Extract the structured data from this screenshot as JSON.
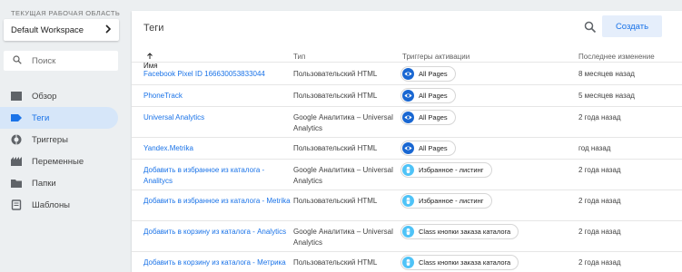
{
  "colors": {
    "accent": "#1a73e8",
    "chip_all_pages": "#1967d2",
    "chip_click": "#4fc3f7"
  },
  "sidebar": {
    "workspace_caption": "ТЕКУЩАЯ РАБОЧАЯ ОБЛАСТЬ",
    "workspace_name": "Default Workspace",
    "search_placeholder": "Поиск",
    "items": [
      {
        "label": "Обзор",
        "icon": "overview-icon"
      },
      {
        "label": "Теги",
        "icon": "tag-icon",
        "active": true
      },
      {
        "label": "Триггеры",
        "icon": "trigger-icon"
      },
      {
        "label": "Переменные",
        "icon": "variables-icon"
      },
      {
        "label": "Папки",
        "icon": "folder-icon"
      },
      {
        "label": "Шаблоны",
        "icon": "template-icon"
      }
    ]
  },
  "panel": {
    "title": "Теги",
    "create_label": "Создать",
    "columns": {
      "name": "Имя",
      "type": "Тип",
      "triggers": "Триггеры активации",
      "modified": "Последнее изменение"
    },
    "rows": [
      {
        "name": "Facebook Pixel ID 166630053833044",
        "type": "Пользовательский HTML",
        "trigger": "All Pages",
        "trigger_icon": "eye-icon",
        "modified": "8 месяцев назад"
      },
      {
        "name": "PhoneTrack",
        "type": "Пользовательский HTML",
        "trigger": "All Pages",
        "trigger_icon": "eye-icon",
        "modified": "5 месяцев назад"
      },
      {
        "name": "Universal Analytics",
        "type": "Google Аналитика – Universal Analytics",
        "trigger": "All Pages",
        "trigger_icon": "eye-icon",
        "modified": "2 года назад"
      },
      {
        "name": "Yandex.Metrika",
        "type": "Пользовательский HTML",
        "trigger": "All Pages",
        "trigger_icon": "eye-icon",
        "modified": "год назад"
      },
      {
        "name": "Добавить в избранное из каталога - Analitycs",
        "type": "Google Аналитика – Universal Analytics",
        "trigger": "Избранное - листинг",
        "trigger_icon": "click-icon",
        "modified": "2 года назад"
      },
      {
        "name": "Добавить в избранное из каталога - Metrika",
        "type": "Пользовательский HTML",
        "trigger": "Избранное - листинг",
        "trigger_icon": "click-icon",
        "modified": "2 года назад"
      },
      {
        "name": "Добавить в корзину из каталога - Analytics",
        "type": "Google Аналитика – Universal Analytics",
        "trigger": "Class кнопки заказа каталога",
        "trigger_icon": "click-icon",
        "modified": "2 года назад"
      },
      {
        "name": "Добавить в корзину из каталога - Метрика",
        "type": "Пользовательский HTML",
        "trigger": "Class кнопки заказа каталога",
        "trigger_icon": "click-icon",
        "modified": "2 года назад"
      }
    ]
  }
}
